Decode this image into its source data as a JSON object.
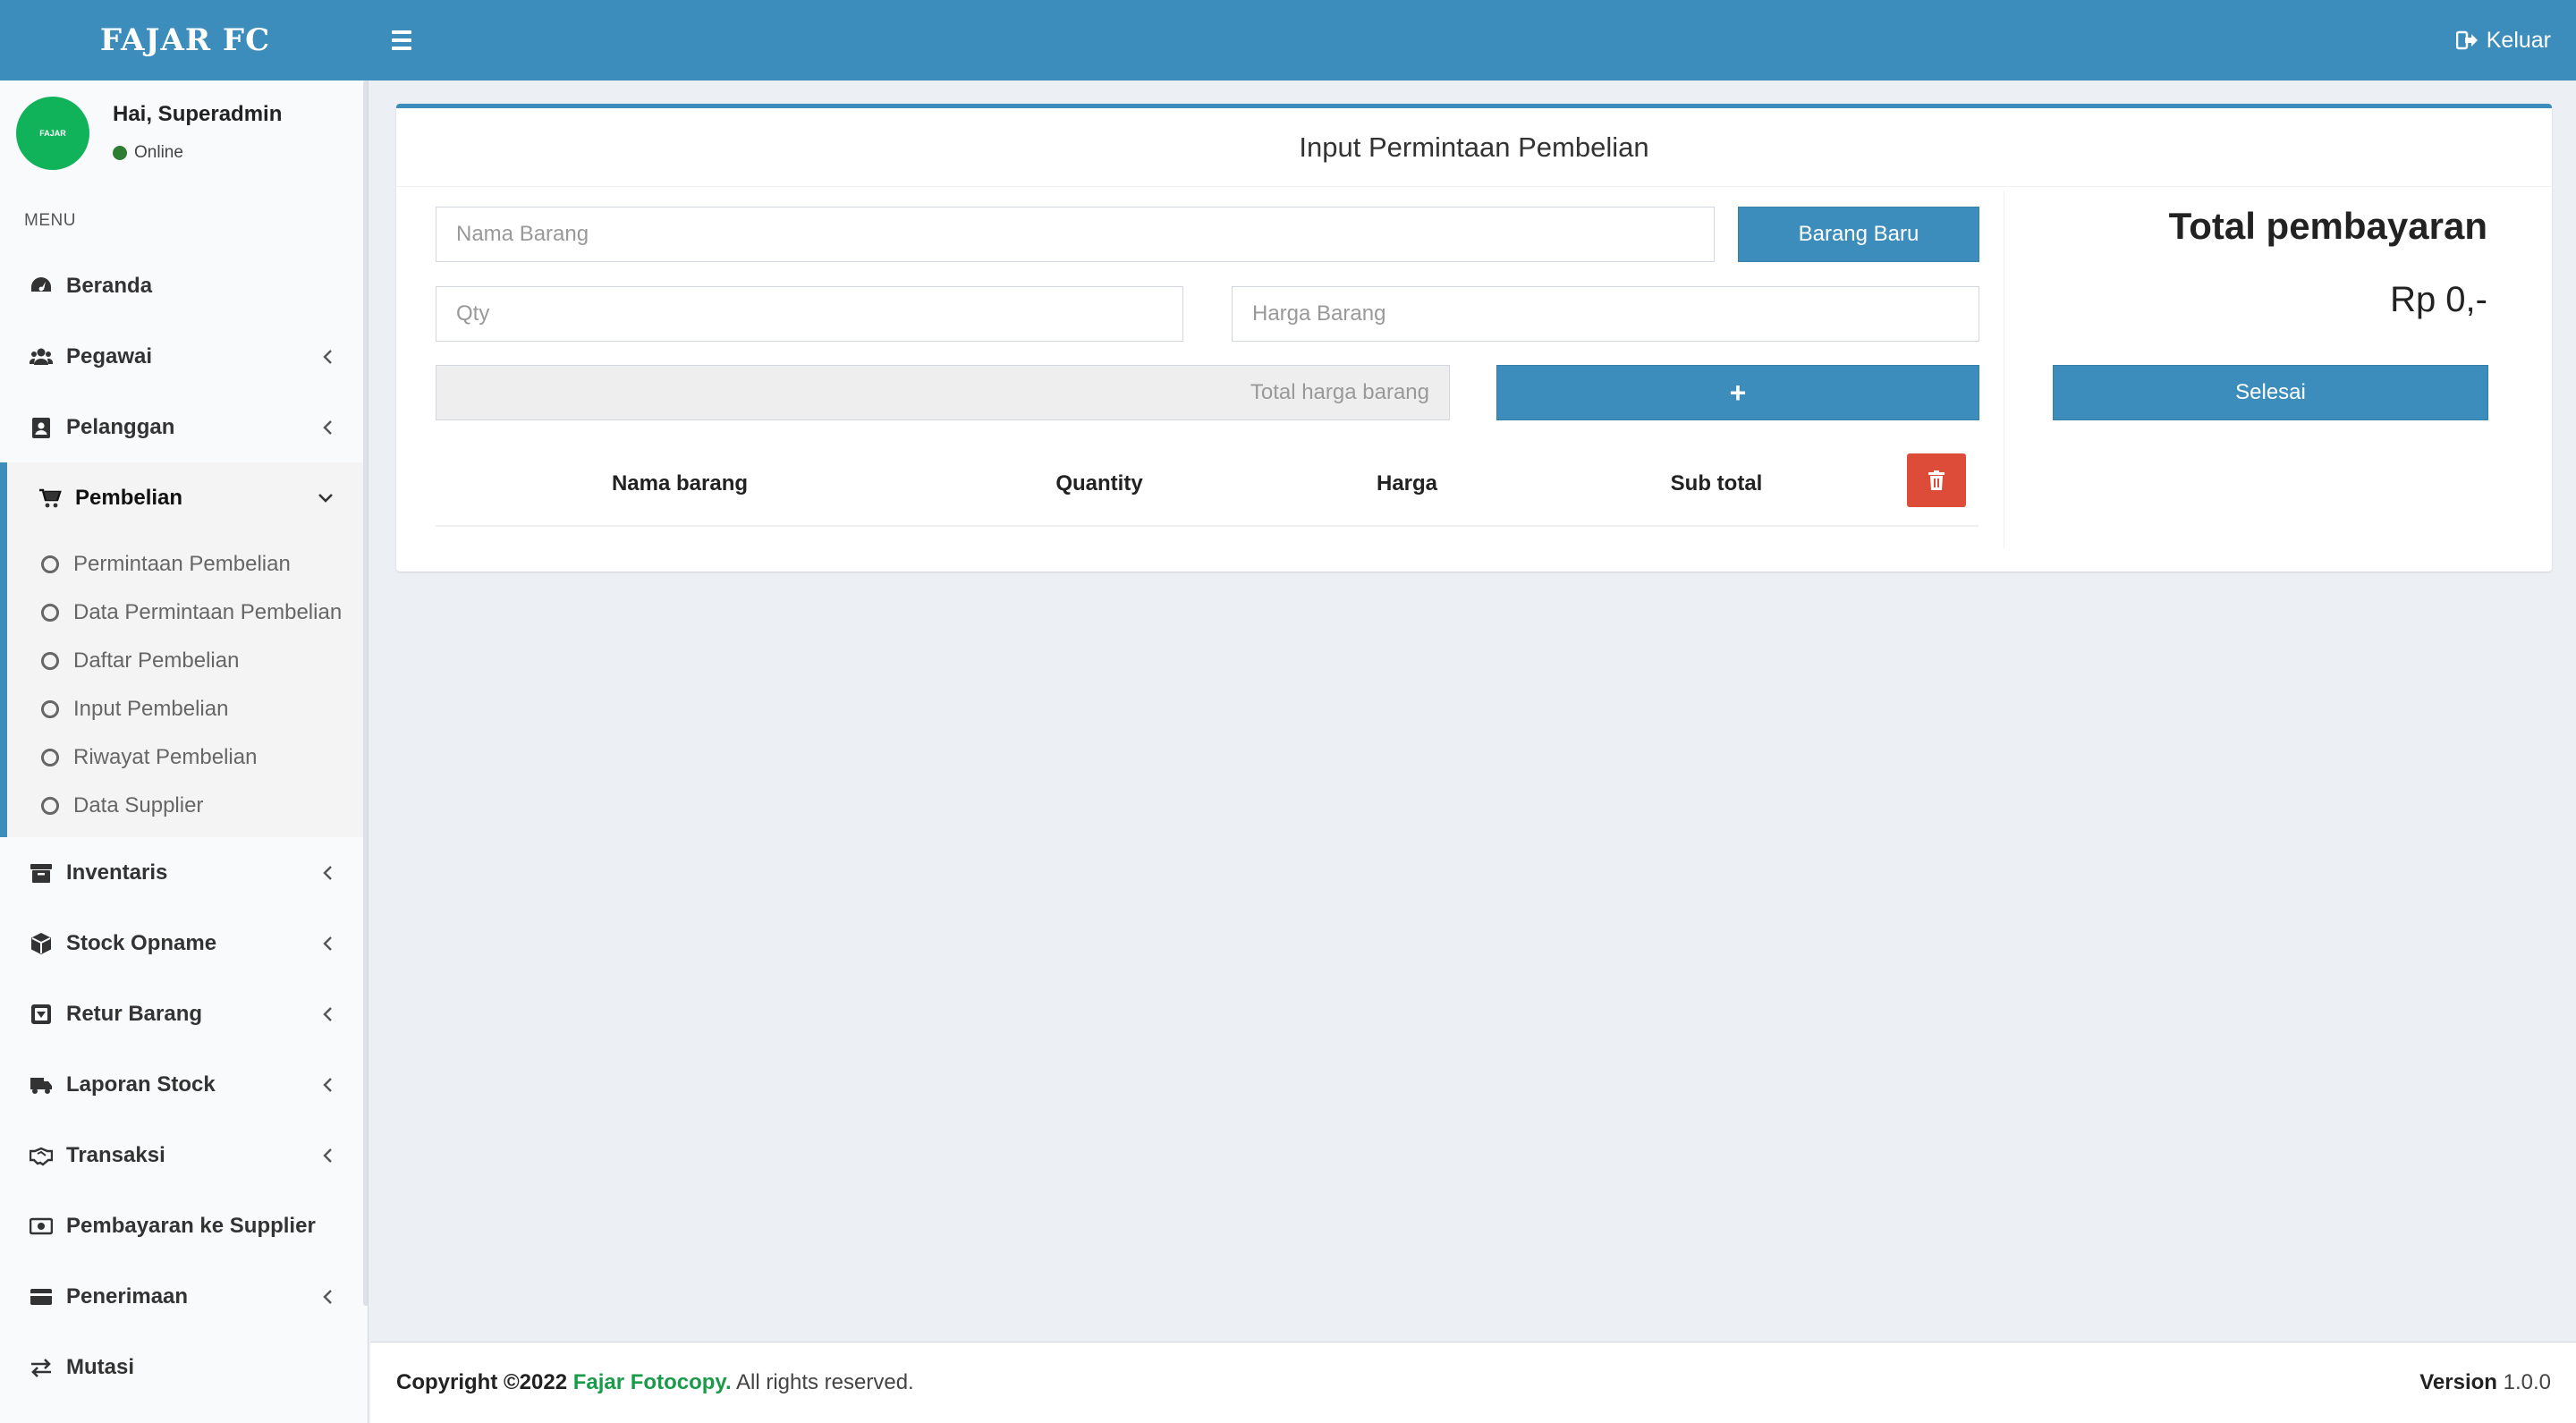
{
  "header": {
    "logo": "FAJAR FC",
    "logout_label": "Keluar"
  },
  "user": {
    "avatar_text": "FAJAR",
    "greeting": "Hai, Superadmin",
    "status": "Online"
  },
  "sidebar": {
    "menu_header": "MENU",
    "items": [
      {
        "label": "Beranda",
        "icon": "dashboard-icon"
      },
      {
        "label": "Pegawai",
        "icon": "users-icon"
      },
      {
        "label": "Pelanggan",
        "icon": "contact-icon"
      },
      {
        "label": "Pembelian",
        "icon": "cart-icon"
      },
      {
        "label": "Inventaris",
        "icon": "archive-icon"
      },
      {
        "label": "Stock Opname",
        "icon": "cube-icon"
      },
      {
        "label": "Retur Barang",
        "icon": "return-box-icon"
      },
      {
        "label": "Laporan Stock",
        "icon": "truck-icon"
      },
      {
        "label": "Transaksi",
        "icon": "handshake-icon"
      },
      {
        "label": "Pembayaran ke Supplier",
        "icon": "money-icon"
      },
      {
        "label": "Penerimaan",
        "icon": "credit-card-icon"
      },
      {
        "label": "Mutasi",
        "icon": "exchange-icon"
      }
    ],
    "submenu": [
      "Permintaan Pembelian",
      "Data Permintaan Pembelian",
      "Daftar Pembelian",
      "Input Pembelian",
      "Riwayat Pembelian",
      "Data Supplier"
    ]
  },
  "form": {
    "title": "Input Permintaan Pembelian",
    "nama_barang_placeholder": "Nama Barang",
    "barang_baru_label": "Barang Baru",
    "qty_placeholder": "Qty",
    "harga_placeholder": "Harga Barang",
    "total_harga_placeholder": "Total harga barang",
    "add_label": "+",
    "table_headers": [
      "Nama barang",
      "Quantity",
      "Harga",
      "Sub total"
    ],
    "total_title": "Total pembayaran",
    "total_value": "Rp 0,-",
    "selesai_label": "Selesai"
  },
  "footer": {
    "copyright_prefix": "Copyright ©2022",
    "brand": "Fajar Fotocopy.",
    "rights": "All rights reserved.",
    "version_label": "Version",
    "version_value": "1.0.0"
  },
  "colors": {
    "primary": "#3c8dbc",
    "danger": "#dd4b39",
    "avatar": "#10b25a",
    "online": "#2e7d32"
  }
}
